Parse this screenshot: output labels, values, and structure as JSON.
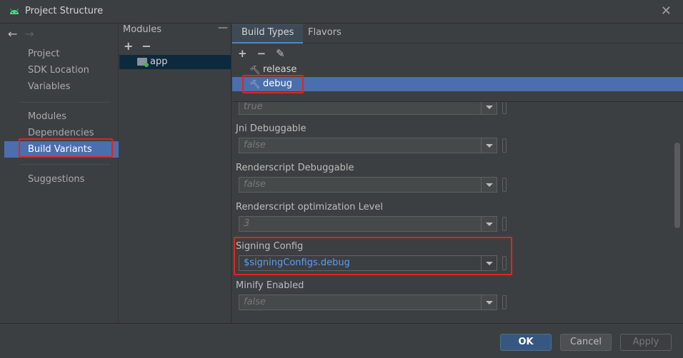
{
  "window": {
    "title": "Project Structure"
  },
  "left_nav": {
    "groups": [
      [
        "Project",
        "SDK Location",
        "Variables"
      ],
      [
        "Modules",
        "Dependencies",
        "Build Variants"
      ],
      [
        "Suggestions"
      ]
    ],
    "selected": "Build Variants"
  },
  "modules": {
    "header": "Modules",
    "items": [
      "app"
    ],
    "selected": "app"
  },
  "tabs": [
    "Build Types",
    "Flavors"
  ],
  "active_tab": "Build Types",
  "build_types": [
    "release",
    "debug"
  ],
  "selected_build_type": "debug",
  "properties": [
    {
      "label": "",
      "value": "true"
    },
    {
      "label": "Jni Debuggable",
      "value": "false"
    },
    {
      "label": "Renderscript Debuggable",
      "value": "false"
    },
    {
      "label": "Renderscript optimization Level",
      "value": "3"
    },
    {
      "label": "Signing Config",
      "value": "$signingConfigs.debug"
    },
    {
      "label": "Minify Enabled",
      "value": "false"
    }
  ],
  "buttons": {
    "ok": "OK",
    "cancel": "Cancel",
    "apply": "Apply"
  },
  "colors": {
    "selection": "#4b6eaf",
    "highlight_box": "#e0261c",
    "link_value": "#589df6"
  }
}
